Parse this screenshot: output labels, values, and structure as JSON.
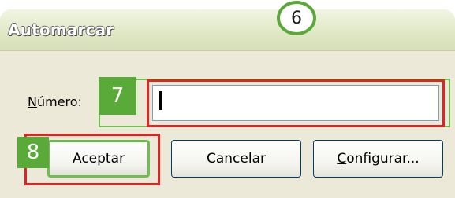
{
  "window": {
    "title": "Automarcar"
  },
  "callouts": {
    "title_marker": "6",
    "input_marker": "7",
    "accept_marker": "8"
  },
  "form": {
    "numero_label_first": "N",
    "numero_label_rest": "úmero:",
    "numero_value": ""
  },
  "buttons": {
    "accept_label": "Aceptar",
    "cancel_label": "Cancelar",
    "config_label_first": "C",
    "config_label_rest": "onfigurar..."
  },
  "colors": {
    "highlight_red": "#e02424",
    "marker_green": "#5aaa3a"
  }
}
